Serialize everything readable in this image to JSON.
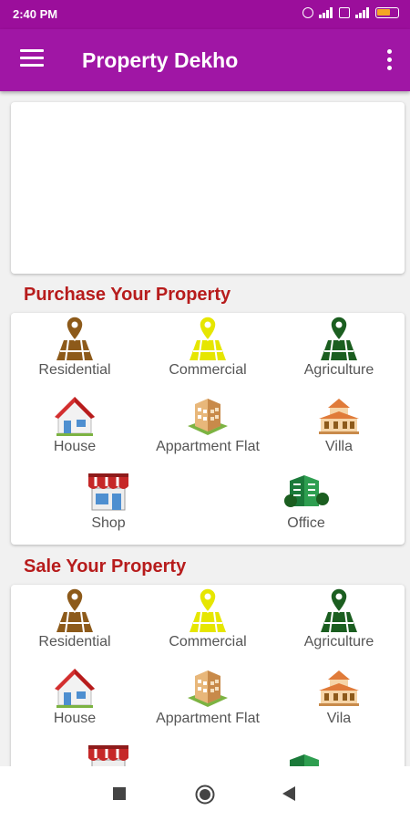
{
  "statusbar": {
    "time": "2:40 PM"
  },
  "appbar": {
    "title": "Property Dekho"
  },
  "purchase": {
    "title": "Purchase Your Property",
    "items": [
      {
        "label": "Residential",
        "icon": "residential-map-pin-icon",
        "color": "#8d5a1a"
      },
      {
        "label": "Commercial",
        "icon": "commercial-map-pin-icon",
        "color": "#e6e600"
      },
      {
        "label": "Agriculture",
        "icon": "agriculture-map-pin-icon",
        "color": "#1b5e20"
      },
      {
        "label": "House",
        "icon": "house-icon"
      },
      {
        "label": "Appartment Flat",
        "icon": "apartment-building-icon"
      },
      {
        "label": "Villa",
        "icon": "villa-icon"
      },
      {
        "label": "Shop",
        "icon": "shop-icon"
      },
      {
        "label": "Office",
        "icon": "office-building-icon"
      }
    ]
  },
  "sale": {
    "title": "Sale Your Property",
    "items": [
      {
        "label": "Residential",
        "icon": "residential-map-pin-icon",
        "color": "#8d5a1a"
      },
      {
        "label": "Commercial",
        "icon": "commercial-map-pin-icon",
        "color": "#e6e600"
      },
      {
        "label": "Agriculture",
        "icon": "agriculture-map-pin-icon",
        "color": "#1b5e20"
      },
      {
        "label": "House",
        "icon": "house-icon"
      },
      {
        "label": "Appartment Flat",
        "icon": "apartment-building-icon"
      },
      {
        "label": "Vila",
        "icon": "villa-icon"
      },
      {
        "label": "",
        "icon": "shop-icon"
      },
      {
        "label": "",
        "icon": "office-building-icon"
      }
    ]
  },
  "colors": {
    "appbar": "#a016a5",
    "statusbar": "#9b0e9b",
    "section_title": "#b71c1c"
  }
}
